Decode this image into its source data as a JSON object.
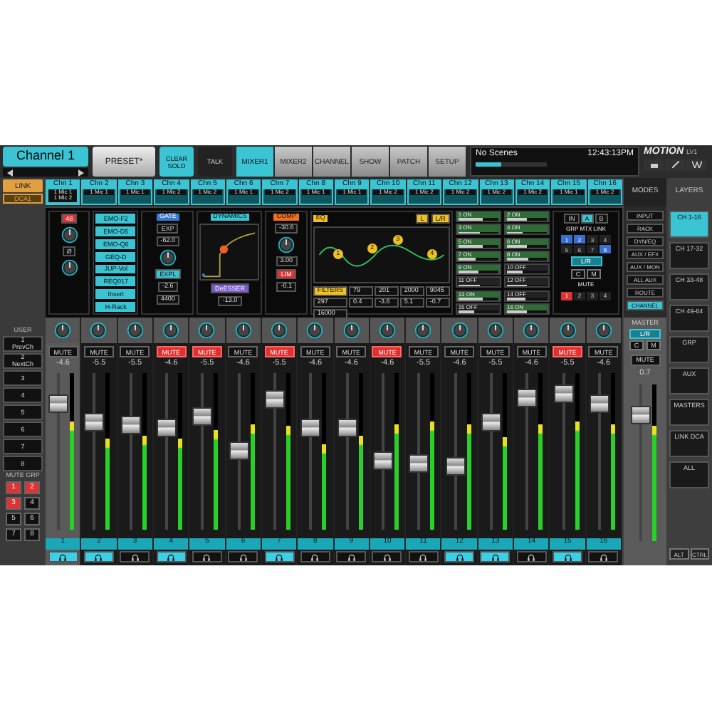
{
  "top": {
    "channel": "Channel 1",
    "preset": "PRESET*",
    "clear_solo": "CLEAR SOLO",
    "talk": "TALK"
  },
  "tabs": [
    {
      "label": "MIXER1",
      "selected": true
    },
    {
      "label": "MIXER2",
      "selected": false
    },
    {
      "label": "CHANNEL",
      "selected": false
    },
    {
      "label": "SHOW",
      "selected": false
    },
    {
      "label": "PATCH",
      "selected": false
    },
    {
      "label": "SETUP",
      "selected": false
    }
  ],
  "scene": {
    "name": "No Scenes",
    "time": "12:43:13PM",
    "level": 0.35
  },
  "logo": {
    "name": "MOTION",
    "model": "LV1"
  },
  "link": "LINK",
  "dca": "DCA1",
  "channel_tabs": [
    {
      "label": "Chn 1",
      "sources": [
        "1 Mic 1",
        "1 Mic 2"
      ],
      "selected": true
    },
    {
      "label": "Chn 2",
      "sources": [
        "1 Mic 1"
      ],
      "selected": false
    },
    {
      "label": "Chn 3",
      "sources": [
        "1 Mic 1"
      ],
      "selected": false
    },
    {
      "label": "Chn 4",
      "sources": [
        "1 Mic 2"
      ],
      "selected": false
    },
    {
      "label": "Chn 5",
      "sources": [
        "1 Mic 2"
      ],
      "selected": false
    },
    {
      "label": "Chn 6",
      "sources": [
        "1 Mic 1"
      ],
      "selected": false
    },
    {
      "label": "Chn 7",
      "sources": [
        "1 Mic 2"
      ],
      "selected": false
    },
    {
      "label": "Chn 8",
      "sources": [
        "1 Mic 1"
      ],
      "selected": false
    },
    {
      "label": "Chn 9",
      "sources": [
        "1 Mic 1"
      ],
      "selected": false
    },
    {
      "label": "Chn 10",
      "sources": [
        "1 Mic 2"
      ],
      "selected": false
    },
    {
      "label": "Chn 11",
      "sources": [
        "1 Mic 2"
      ],
      "selected": false
    },
    {
      "label": "Chn 12",
      "sources": [
        "1 Mic 2"
      ],
      "selected": false
    },
    {
      "label": "Chn 13",
      "sources": [
        "1 Mic 2"
      ],
      "selected": false
    },
    {
      "label": "Chn 14",
      "sources": [
        "1 Mic 2"
      ],
      "selected": false
    },
    {
      "label": "Chn 15",
      "sources": [
        "1 Mic 1"
      ],
      "selected": false
    },
    {
      "label": "Chn 16",
      "sources": [
        "1 Mic 2"
      ],
      "selected": false
    }
  ],
  "processing": {
    "input": [
      {
        "label": "48",
        "on": true
      },
      {
        "label": "Ø",
        "on": false
      }
    ],
    "rack": [
      "EMO-F2",
      "EMO-D5",
      "EMO-Q6",
      "GEQ-D",
      "JUP-Vol",
      "REQ017",
      "Insert",
      "H-Rack"
    ],
    "gate": {
      "label": "GATE",
      "button": "EXP",
      "threshold": "-62.0",
      "key": "EXPL",
      "range": "-2.6",
      "freq": "4400"
    },
    "dynamics": {
      "label": "DYNAMICS",
      "deesser": "DeESSER",
      "value": "-13.0"
    },
    "comp": {
      "label": "COMP",
      "threshold": "-30.6",
      "ratio": "3.00",
      "limiter": "LIM",
      "limit": "-0.1"
    },
    "eq": {
      "label": "EQ",
      "buttons": [
        "L",
        "L/R"
      ],
      "nodes": [
        "1",
        "2",
        "3",
        "4"
      ],
      "filters": "FILTERS",
      "filter_freqs": [
        "297",
        "16000"
      ],
      "bands": [
        {
          "freq": "79",
          "gain": "0.4"
        },
        {
          "freq": "201",
          "gain": "-3.6"
        },
        {
          "freq": "2000",
          "gain": "5.1"
        },
        {
          "freq": "9045",
          "gain": "-0.7"
        }
      ]
    },
    "sends": [
      {
        "label": "1 ON",
        "on": true,
        "level": 0.6
      },
      {
        "label": "2 ON",
        "on": true,
        "level": 0.5
      },
      {
        "label": "3 ON",
        "on": true,
        "level": 0.55
      },
      {
        "label": "4 ON",
        "on": true,
        "level": 0.4
      },
      {
        "label": "5 ON",
        "on": true,
        "level": 0.6
      },
      {
        "label": "6 ON",
        "on": true,
        "level": 0.5
      },
      {
        "label": "7 ON",
        "on": true,
        "level": 0.45
      },
      {
        "label": "8 ON",
        "on": true,
        "level": 0.55
      },
      {
        "label": "9 ON",
        "on": true,
        "level": 0.5
      },
      {
        "label": "10 OFF",
        "on": false,
        "level": 0.4
      },
      {
        "label": "11 OFF",
        "on": false,
        "level": 0.55
      },
      {
        "label": "12 OFF",
        "on": false,
        "level": 0.5
      },
      {
        "label": "13 ON",
        "on": true,
        "level": 0.6
      },
      {
        "label": "14 OFF",
        "on": false,
        "level": 0.45
      },
      {
        "label": "15 OFF",
        "on": false,
        "level": 0.4
      },
      {
        "label": "16 ON",
        "on": true,
        "level": 0.5
      }
    ],
    "routing": {
      "buses": [
        {
          "label": "IN",
          "selected": false
        },
        {
          "label": "A",
          "selected": true
        },
        {
          "label": "B",
          "selected": false
        }
      ],
      "grp": "GRP",
      "mtx": "MTX",
      "grp_cells": [
        {
          "label": "1",
          "on": true
        },
        {
          "label": "2",
          "on": true
        },
        {
          "label": "3",
          "on": false
        },
        {
          "label": "4",
          "on": false
        },
        {
          "label": "5",
          "on": false
        },
        {
          "label": "6",
          "on": false
        },
        {
          "label": "7",
          "on": false
        },
        {
          "label": "8",
          "on": true
        }
      ],
      "lr": {
        "label": "L/R",
        "on": true
      },
      "c": "C",
      "m": "M",
      "link": "LINK",
      "mute": "MUTE",
      "mute_cells": [
        {
          "label": "1",
          "on": true
        },
        {
          "label": "2",
          "on": false
        },
        {
          "label": "3",
          "on": false
        },
        {
          "label": "4",
          "on": false
        }
      ]
    }
  },
  "user": {
    "title": "USER",
    "keys": [
      {
        "num": "1",
        "label": "PrevCh"
      },
      {
        "num": "2",
        "label": "NextCh"
      },
      {
        "num": "3"
      },
      {
        "num": "4"
      },
      {
        "num": "5"
      },
      {
        "num": "6"
      },
      {
        "num": "7"
      },
      {
        "num": "8"
      }
    ]
  },
  "mute_groups": {
    "title": "MUTE GRP",
    "buttons": [
      {
        "label": "1",
        "on": true
      },
      {
        "label": "2",
        "on": true
      },
      {
        "label": "3",
        "on": true
      },
      {
        "label": "4",
        "on": false
      },
      {
        "label": "5",
        "on": false
      },
      {
        "label": "6",
        "on": false
      },
      {
        "label": "7",
        "on": false
      },
      {
        "label": "8",
        "on": false
      }
    ]
  },
  "strips": [
    {
      "num": "1",
      "mute": "MUTE",
      "muted": false,
      "value": "-4.6",
      "fader": {
        "level": 0.83
      },
      "meter": {
        "level": 0.69
      },
      "solo": true,
      "selected": true
    },
    {
      "num": "2",
      "mute": "MUTE",
      "muted": false,
      "value": "-5.5",
      "fader": {
        "level": 0.7
      },
      "meter": {
        "level": 0.58
      },
      "solo": true,
      "selected": false
    },
    {
      "num": "3",
      "mute": "MUTE",
      "muted": false,
      "value": "-5.5",
      "fader": {
        "level": 0.68
      },
      "meter": {
        "level": 0.6
      },
      "solo": false,
      "selected": false
    },
    {
      "num": "4",
      "mute": "MUTE",
      "muted": true,
      "value": "-4.6",
      "fader": {
        "level": 0.66
      },
      "meter": {
        "level": 0.58
      },
      "solo": true,
      "selected": false
    },
    {
      "num": "5",
      "mute": "MUTE",
      "muted": true,
      "value": "-5.5",
      "fader": {
        "level": 0.74
      },
      "meter": {
        "level": 0.64
      },
      "solo": false,
      "selected": false
    },
    {
      "num": "6",
      "mute": "MUTE",
      "muted": false,
      "value": "-4.6",
      "fader": {
        "level": 0.49
      },
      "meter": {
        "level": 0.67
      },
      "solo": false,
      "selected": false
    },
    {
      "num": "7",
      "mute": "MUTE",
      "muted": true,
      "value": "-5.5",
      "fader": {
        "level": 0.86
      },
      "meter": {
        "level": 0.66
      },
      "solo": true,
      "selected": false
    },
    {
      "num": "8",
      "mute": "MUTE",
      "muted": false,
      "value": "-4.6",
      "fader": {
        "level": 0.66
      },
      "meter": {
        "level": 0.55
      },
      "solo": false,
      "selected": false
    },
    {
      "num": "9",
      "mute": "MUTE",
      "muted": false,
      "value": "-4.6",
      "fader": {
        "level": 0.66
      },
      "meter": {
        "level": 0.6
      },
      "solo": false,
      "selected": false
    },
    {
      "num": "10",
      "mute": "MUTE",
      "muted": true,
      "value": "-4.6",
      "fader": {
        "level": 0.42
      },
      "meter": {
        "level": 0.67
      },
      "solo": false,
      "selected": false
    },
    {
      "num": "11",
      "mute": "MUTE",
      "muted": false,
      "value": "-5.5",
      "fader": {
        "level": 0.4
      },
      "meter": {
        "level": 0.69
      },
      "solo": false,
      "selected": false
    },
    {
      "num": "12",
      "mute": "MUTE",
      "muted": false,
      "value": "-4.6",
      "fader": {
        "level": 0.38
      },
      "meter": {
        "level": 0.67
      },
      "solo": true,
      "selected": false
    },
    {
      "num": "13",
      "mute": "MUTE",
      "muted": false,
      "value": "-5.5",
      "fader": {
        "level": 0.7
      },
      "meter": {
        "level": 0.59
      },
      "solo": true,
      "selected": false
    },
    {
      "num": "14",
      "mute": "MUTE",
      "muted": false,
      "value": "-4.6",
      "fader": {
        "level": 0.87
      },
      "meter": {
        "level": 0.67
      },
      "solo": false,
      "selected": false
    },
    {
      "num": "15",
      "mute": "MUTE",
      "muted": true,
      "value": "-5.5",
      "fader": {
        "level": 0.9
      },
      "meter": {
        "level": 0.69
      },
      "solo": true,
      "selected": false
    },
    {
      "num": "16",
      "mute": "MUTE",
      "muted": false,
      "value": "-4.6",
      "fader": {
        "level": 0.83
      },
      "meter": {
        "level": 0.67
      },
      "solo": false,
      "selected": false
    }
  ],
  "modes": {
    "title": "MODES",
    "items": [
      {
        "label": "INPUT",
        "selected": false
      },
      {
        "label": "RACK",
        "selected": false
      },
      {
        "label": "DYN/EQ",
        "selected": false
      },
      {
        "label": "AUX / EFX",
        "selected": false
      },
      {
        "label": "AUX / MON",
        "selected": false
      },
      {
        "label": "ALL AUX",
        "selected": false
      },
      {
        "label": "ROUTE",
        "selected": false
      },
      {
        "label": "CHANNEL",
        "selected": true
      }
    ]
  },
  "master": {
    "title": "MASTER",
    "lr": {
      "label": "L/R",
      "on": true
    },
    "c": "C",
    "m": "M",
    "mute": {
      "label": "MUTE",
      "muted": false
    },
    "value": "0.7",
    "fader": {
      "level": 0.83
    },
    "meter": {
      "level": 0.74
    }
  },
  "layers": {
    "title": "LAYERS",
    "items": [
      {
        "label": "CH 1-16",
        "selected": true
      },
      {
        "label": "CH 17-32",
        "selected": false
      },
      {
        "label": "CH 33-48",
        "selected": false
      },
      {
        "label": "CH 49-64",
        "selected": false
      },
      {
        "label": "GRP",
        "selected": false
      },
      {
        "label": "AUX",
        "selected": false
      },
      {
        "label": "MASTERS",
        "selected": false
      },
      {
        "label": "LINK DCA",
        "selected": false
      },
      {
        "label": "ALL",
        "selected": false
      }
    ],
    "keys": [
      "ALT",
      "CTRL"
    ]
  }
}
